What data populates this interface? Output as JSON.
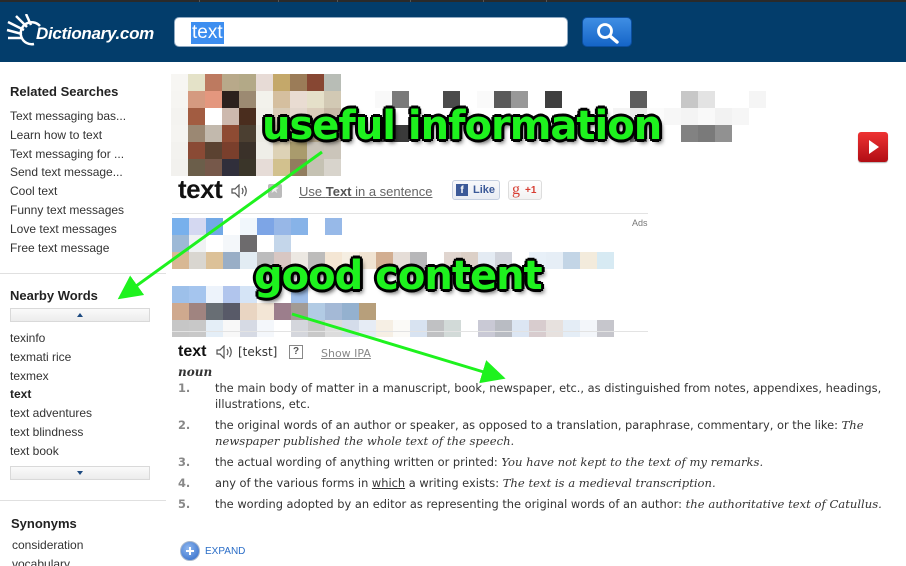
{
  "header": {
    "logo_text": "Dictionary.com",
    "search_value": "text",
    "search_button_icon": "magnifier-icon"
  },
  "sidebar": {
    "related": {
      "title": "Related Searches",
      "items": [
        "Text messaging bas...",
        "Learn how to text",
        "Text messaging for ...",
        "Send text message...",
        "Cool text",
        "Funny text messages",
        "Love text messages",
        "Free text message"
      ]
    },
    "nearby": {
      "title": "Nearby Words",
      "items": [
        "texinfo",
        "texmati rice",
        "texmex",
        "text",
        "text adventures",
        "text blindness",
        "text book"
      ],
      "current": "text"
    },
    "synonyms": {
      "title": "Synonyms",
      "items": [
        "consideration",
        "vocabulary"
      ]
    }
  },
  "main": {
    "headword": "text",
    "use_link_prefix": "Use ",
    "use_link_word": "Text",
    "use_link_suffix": " in a sentence",
    "fb_like": "Like",
    "fb_icon": "f",
    "gplus_g": "g",
    "gplus_label": "+1",
    "ads_label": "Ads",
    "entry": {
      "word": "text",
      "pronunciation": "[tekst]",
      "help_label": "?",
      "show_ipa": "Show IPA",
      "part_of_speech": "noun",
      "definitions": [
        {
          "num": "1.",
          "text": "the main body of matter in a manuscript, book, newspaper, etc., as distinguished from notes, appendixes, headings, illustrations, etc.",
          "example": ""
        },
        {
          "num": "2.",
          "text": "the original words of an author or speaker, as opposed to a translation, paraphrase, commentary, or the like:",
          "example": "The newspaper published the whole text of the speech."
        },
        {
          "num": "3.",
          "text": "the actual wording of anything written or printed:",
          "example": "You have not kept to the text of my remarks."
        },
        {
          "num": "4.",
          "text_before": "any of the various forms in ",
          "link": "which",
          "text_after": " a writing exists:",
          "example": "The text is a medieval transcription."
        },
        {
          "num": "5.",
          "text": "the wording adopted by an editor as representing the original words of an author:",
          "example": "the authoritative text of Catullus."
        }
      ],
      "expand_label": "EXPAND"
    }
  },
  "annotations": {
    "top": "useful information",
    "middle": "good content",
    "color": "#1ef21e"
  }
}
